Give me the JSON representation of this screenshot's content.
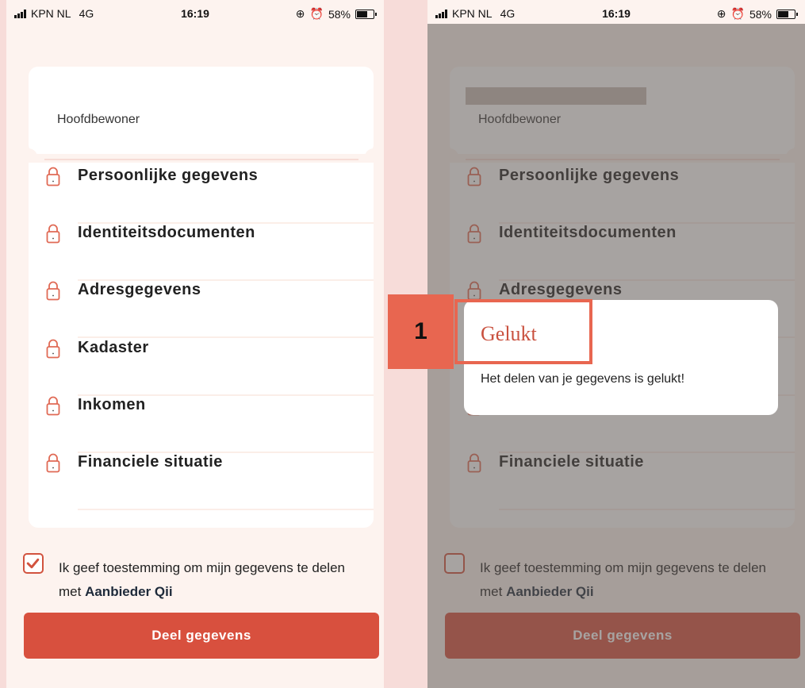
{
  "colors": {
    "accent": "#d8503e",
    "page_bg": "#f7dcd9",
    "screen_bg": "#fdf3ef",
    "callout": "#e86650"
  },
  "status_bar": {
    "carrier": "KPN NL",
    "network": "4G",
    "time": "16:19",
    "battery": "58%"
  },
  "card": {
    "title": "Hoofdbewoner"
  },
  "categories": [
    {
      "label": "Persoonlijke gegevens",
      "icon": "lock-icon"
    },
    {
      "label": "Identiteitsdocumenten",
      "icon": "lock-icon"
    },
    {
      "label": "Adresgegevens",
      "icon": "lock-icon"
    },
    {
      "label": "Kadaster",
      "icon": "lock-icon"
    },
    {
      "label": "Inkomen",
      "icon": "lock-icon"
    },
    {
      "label": "Financiele situatie",
      "icon": "lock-icon"
    }
  ],
  "consent": {
    "text": "Ik geef toestemming om mijn gegevens te delen met",
    "provider": "Aanbieder Qii"
  },
  "left_screen": {
    "consent_checked": true
  },
  "right_screen": {
    "consent_checked": false
  },
  "share_button": {
    "label": "Deel gegevens"
  },
  "dialog": {
    "title": "Gelukt",
    "message": "Het delen van je gegevens is gelukt!"
  },
  "callout": {
    "number": "1"
  }
}
